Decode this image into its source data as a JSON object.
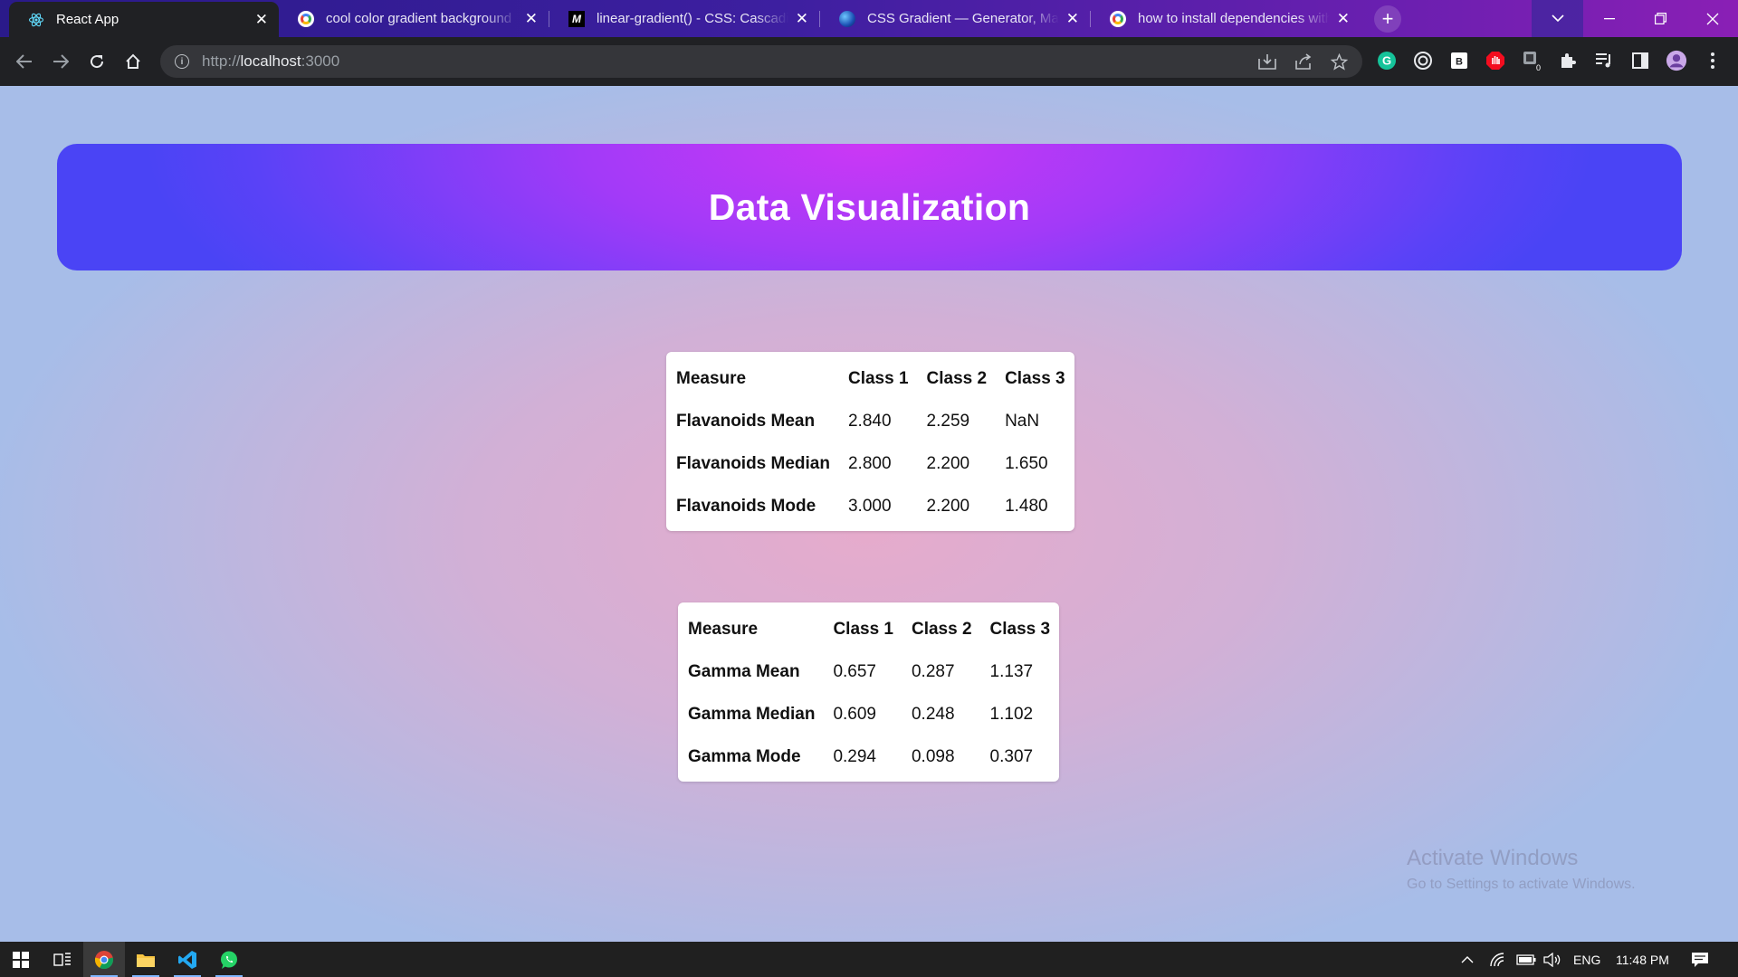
{
  "browser": {
    "tabs": [
      {
        "title": "React App",
        "favicon": "react-icon",
        "active": true
      },
      {
        "title": "cool color gradient background",
        "favicon": "google-icon",
        "active": false
      },
      {
        "title": "linear-gradient() - CSS: Cascading",
        "favicon": "mdn-icon",
        "active": false
      },
      {
        "title": "CSS Gradient — Generator, Maker",
        "favicon": "cssgradient-icon",
        "active": false
      },
      {
        "title": "how to install dependencies with",
        "favicon": "google-icon",
        "active": false
      }
    ],
    "tab_close": "✕",
    "new_tab": "+",
    "address": {
      "scheme": "http://",
      "host": "localhost",
      "port": ":3000"
    },
    "window_controls": {
      "minimize": "—",
      "restore": "❐",
      "close": "✕",
      "tab_search": "⌄"
    }
  },
  "page": {
    "title": "Data Visualization",
    "tables": [
      {
        "headers": [
          "Measure",
          "Class 1",
          "Class 2",
          "Class 3"
        ],
        "rows": [
          [
            "Flavanoids Mean",
            "2.840",
            "2.259",
            "NaN"
          ],
          [
            "Flavanoids Median",
            "2.800",
            "2.200",
            "1.650"
          ],
          [
            "Flavanoids Mode",
            "3.000",
            "2.200",
            "1.480"
          ]
        ]
      },
      {
        "headers": [
          "Measure",
          "Class 1",
          "Class 2",
          "Class 3"
        ],
        "rows": [
          [
            "Gamma Mean",
            "0.657",
            "0.287",
            "1.137"
          ],
          [
            "Gamma Median",
            "0.609",
            "0.248",
            "1.102"
          ],
          [
            "Gamma Mode",
            "0.294",
            "0.098",
            "0.307"
          ]
        ]
      }
    ],
    "watermark": {
      "line1": "Activate Windows",
      "line2": "Go to Settings to activate Windows."
    }
  },
  "taskbar": {
    "apps": [
      "start-icon",
      "task-view-icon",
      "chrome-icon",
      "file-explorer-icon",
      "vscode-icon",
      "whatsapp-icon"
    ],
    "language": "ENG",
    "time": "11:48 PM"
  },
  "colors": {
    "banner_start": "#4a44f5",
    "banner_center": "#cc38f5",
    "page_center": "#e6abcc",
    "page_edge": "#a7bde8"
  }
}
